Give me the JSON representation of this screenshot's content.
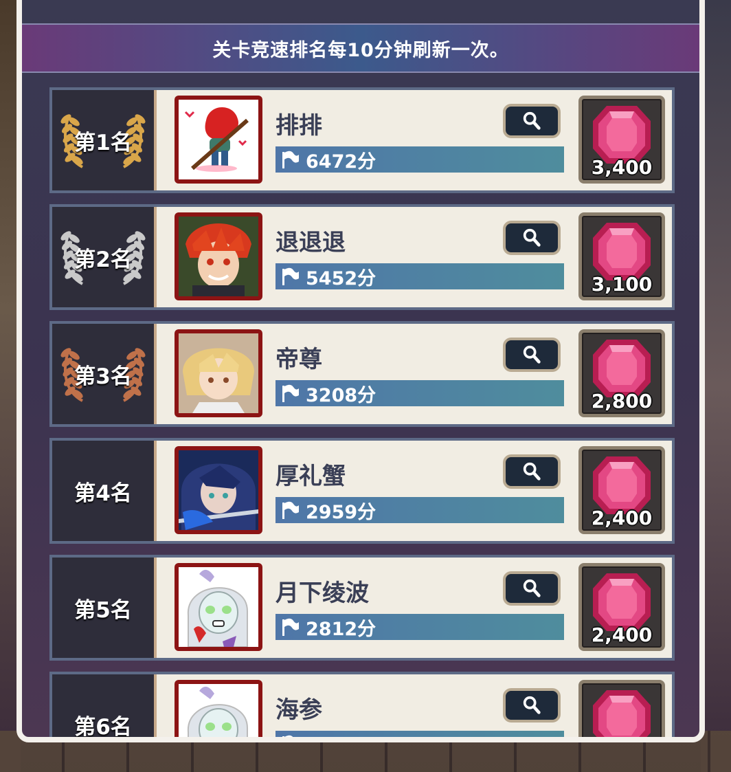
{
  "notice": "关卡竞速排名每10分钟刷新一次。",
  "rows": [
    {
      "rank": "第1名",
      "laurel": "gold",
      "name": "排排",
      "score": "6472分",
      "reward": "3,400",
      "avatar": "red-hat-cartoon"
    },
    {
      "rank": "第2名",
      "laurel": "silver",
      "name": "退退退",
      "score": "5452分",
      "reward": "3,100",
      "avatar": "red-hair-boy"
    },
    {
      "rank": "第3名",
      "laurel": "bronze",
      "name": "帝尊",
      "score": "3208分",
      "reward": "2,800",
      "avatar": "blonde-girl"
    },
    {
      "rank": "第4名",
      "laurel": "none",
      "name": "厚礼蟹",
      "score": "2959分",
      "reward": "2,400",
      "avatar": "blue-hair-girl"
    },
    {
      "rank": "第5名",
      "laurel": "none",
      "name": "月下绫波",
      "score": "2812分",
      "reward": "2,400",
      "avatar": "sketch-girl"
    },
    {
      "rank": "第6名",
      "laurel": "none",
      "name": "海参",
      "score": "",
      "reward": "",
      "avatar": "sketch-girl"
    }
  ],
  "colors": {
    "gold": "#d9a64a",
    "silver": "#c9c9c9",
    "bronze": "#c0714a",
    "avatar_border": "#8c1414",
    "gem": "#e0447a"
  }
}
